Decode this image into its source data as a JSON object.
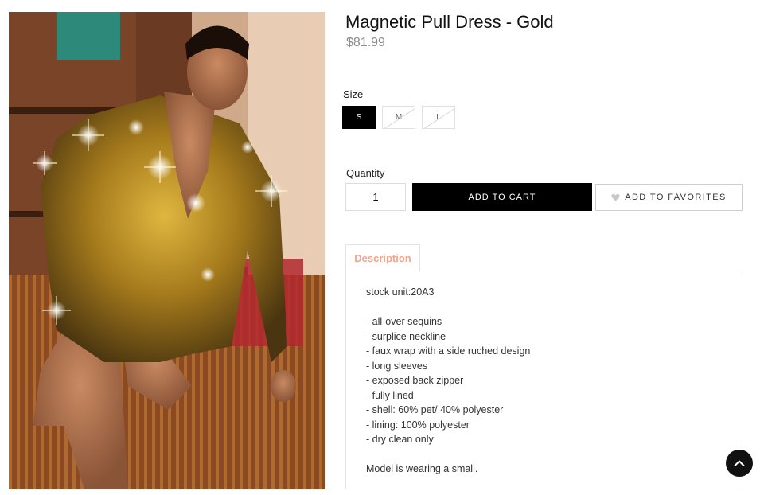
{
  "product": {
    "title": "Magnetic Pull Dress - Gold",
    "price": "$81.99",
    "image_alt": "Model wearing gold sequin wrap dress"
  },
  "size": {
    "label": "Size",
    "options": [
      {
        "label": "S",
        "state": "selected"
      },
      {
        "label": "M",
        "state": "unavailable"
      },
      {
        "label": "L",
        "state": "unavailable"
      }
    ]
  },
  "quantity": {
    "label": "Quantity",
    "value": "1"
  },
  "actions": {
    "add_to_cart": "ADD TO CART",
    "add_to_favorites": "ADD TO FAVORITES",
    "favorites_icon": "heart-icon"
  },
  "description": {
    "tab_label": "Description",
    "stock_unit": "stock unit:20A3",
    "features": [
      "- all-over sequins",
      "- surplice neckline",
      "- faux wrap with a side ruched design",
      "- long sleeves",
      "- exposed back zipper",
      "- fully lined",
      "- shell: 60% pet/ 40% polyester",
      "- lining: 100% polyester",
      "- dry clean only"
    ],
    "model_note": "Model is wearing a small."
  },
  "colors": {
    "accent_tab": "#f0a58d",
    "button_primary": "#000000",
    "price_gray": "#8a8a8a"
  },
  "back_to_top_icon": "chevron-up-icon"
}
